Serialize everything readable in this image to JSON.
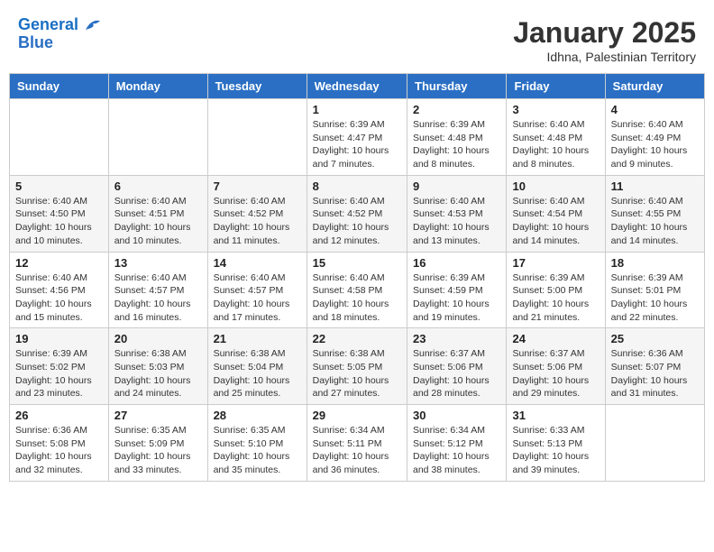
{
  "header": {
    "logo_line1": "General",
    "logo_line2": "Blue",
    "month_year": "January 2025",
    "location": "Idhna, Palestinian Territory"
  },
  "weekdays": [
    "Sunday",
    "Monday",
    "Tuesday",
    "Wednesday",
    "Thursday",
    "Friday",
    "Saturday"
  ],
  "weeks": [
    [
      {
        "day": "",
        "info": ""
      },
      {
        "day": "",
        "info": ""
      },
      {
        "day": "",
        "info": ""
      },
      {
        "day": "1",
        "info": "Sunrise: 6:39 AM\nSunset: 4:47 PM\nDaylight: 10 hours\nand 7 minutes."
      },
      {
        "day": "2",
        "info": "Sunrise: 6:39 AM\nSunset: 4:48 PM\nDaylight: 10 hours\nand 8 minutes."
      },
      {
        "day": "3",
        "info": "Sunrise: 6:40 AM\nSunset: 4:48 PM\nDaylight: 10 hours\nand 8 minutes."
      },
      {
        "day": "4",
        "info": "Sunrise: 6:40 AM\nSunset: 4:49 PM\nDaylight: 10 hours\nand 9 minutes."
      }
    ],
    [
      {
        "day": "5",
        "info": "Sunrise: 6:40 AM\nSunset: 4:50 PM\nDaylight: 10 hours\nand 10 minutes."
      },
      {
        "day": "6",
        "info": "Sunrise: 6:40 AM\nSunset: 4:51 PM\nDaylight: 10 hours\nand 10 minutes."
      },
      {
        "day": "7",
        "info": "Sunrise: 6:40 AM\nSunset: 4:52 PM\nDaylight: 10 hours\nand 11 minutes."
      },
      {
        "day": "8",
        "info": "Sunrise: 6:40 AM\nSunset: 4:52 PM\nDaylight: 10 hours\nand 12 minutes."
      },
      {
        "day": "9",
        "info": "Sunrise: 6:40 AM\nSunset: 4:53 PM\nDaylight: 10 hours\nand 13 minutes."
      },
      {
        "day": "10",
        "info": "Sunrise: 6:40 AM\nSunset: 4:54 PM\nDaylight: 10 hours\nand 14 minutes."
      },
      {
        "day": "11",
        "info": "Sunrise: 6:40 AM\nSunset: 4:55 PM\nDaylight: 10 hours\nand 14 minutes."
      }
    ],
    [
      {
        "day": "12",
        "info": "Sunrise: 6:40 AM\nSunset: 4:56 PM\nDaylight: 10 hours\nand 15 minutes."
      },
      {
        "day": "13",
        "info": "Sunrise: 6:40 AM\nSunset: 4:57 PM\nDaylight: 10 hours\nand 16 minutes."
      },
      {
        "day": "14",
        "info": "Sunrise: 6:40 AM\nSunset: 4:57 PM\nDaylight: 10 hours\nand 17 minutes."
      },
      {
        "day": "15",
        "info": "Sunrise: 6:40 AM\nSunset: 4:58 PM\nDaylight: 10 hours\nand 18 minutes."
      },
      {
        "day": "16",
        "info": "Sunrise: 6:39 AM\nSunset: 4:59 PM\nDaylight: 10 hours\nand 19 minutes."
      },
      {
        "day": "17",
        "info": "Sunrise: 6:39 AM\nSunset: 5:00 PM\nDaylight: 10 hours\nand 21 minutes."
      },
      {
        "day": "18",
        "info": "Sunrise: 6:39 AM\nSunset: 5:01 PM\nDaylight: 10 hours\nand 22 minutes."
      }
    ],
    [
      {
        "day": "19",
        "info": "Sunrise: 6:39 AM\nSunset: 5:02 PM\nDaylight: 10 hours\nand 23 minutes."
      },
      {
        "day": "20",
        "info": "Sunrise: 6:38 AM\nSunset: 5:03 PM\nDaylight: 10 hours\nand 24 minutes."
      },
      {
        "day": "21",
        "info": "Sunrise: 6:38 AM\nSunset: 5:04 PM\nDaylight: 10 hours\nand 25 minutes."
      },
      {
        "day": "22",
        "info": "Sunrise: 6:38 AM\nSunset: 5:05 PM\nDaylight: 10 hours\nand 27 minutes."
      },
      {
        "day": "23",
        "info": "Sunrise: 6:37 AM\nSunset: 5:06 PM\nDaylight: 10 hours\nand 28 minutes."
      },
      {
        "day": "24",
        "info": "Sunrise: 6:37 AM\nSunset: 5:06 PM\nDaylight: 10 hours\nand 29 minutes."
      },
      {
        "day": "25",
        "info": "Sunrise: 6:36 AM\nSunset: 5:07 PM\nDaylight: 10 hours\nand 31 minutes."
      }
    ],
    [
      {
        "day": "26",
        "info": "Sunrise: 6:36 AM\nSunset: 5:08 PM\nDaylight: 10 hours\nand 32 minutes."
      },
      {
        "day": "27",
        "info": "Sunrise: 6:35 AM\nSunset: 5:09 PM\nDaylight: 10 hours\nand 33 minutes."
      },
      {
        "day": "28",
        "info": "Sunrise: 6:35 AM\nSunset: 5:10 PM\nDaylight: 10 hours\nand 35 minutes."
      },
      {
        "day": "29",
        "info": "Sunrise: 6:34 AM\nSunset: 5:11 PM\nDaylight: 10 hours\nand 36 minutes."
      },
      {
        "day": "30",
        "info": "Sunrise: 6:34 AM\nSunset: 5:12 PM\nDaylight: 10 hours\nand 38 minutes."
      },
      {
        "day": "31",
        "info": "Sunrise: 6:33 AM\nSunset: 5:13 PM\nDaylight: 10 hours\nand 39 minutes."
      },
      {
        "day": "",
        "info": ""
      }
    ]
  ]
}
